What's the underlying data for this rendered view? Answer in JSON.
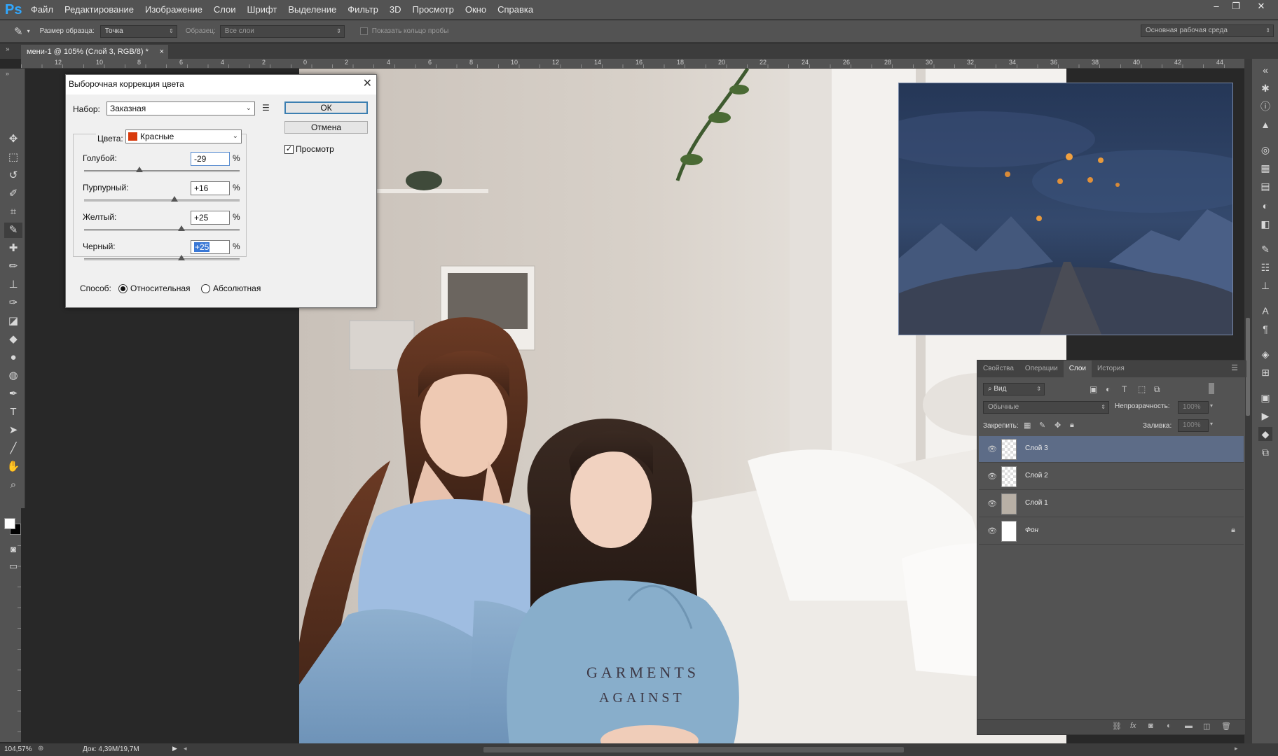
{
  "app": {
    "logo": "Ps"
  },
  "menu": [
    "Файл",
    "Редактирование",
    "Изображение",
    "Слои",
    "Шрифт",
    "Выделение",
    "Фильтр",
    "3D",
    "Просмотр",
    "Окно",
    "Справка"
  ],
  "window_controls": {
    "minimize": "–",
    "restore": "❐",
    "close": "✕"
  },
  "options_bar": {
    "sample_size_label": "Размер образца:",
    "sample_size_value": "Точка",
    "sample_label": "Образец:",
    "sample_value": "Все слои",
    "show_ring_label": "Показать кольцо пробы",
    "workspace": "Основная рабочая среда"
  },
  "document_tab": {
    "title": "мени-1 @ 105% (Слой 3, RGB/8) *",
    "close": "×"
  },
  "ruler_ticks": [
    "12",
    "10",
    "8",
    "6",
    "4",
    "2",
    "0",
    "2",
    "4",
    "6",
    "8",
    "10",
    "12",
    "14",
    "16",
    "18",
    "20",
    "22",
    "24",
    "26",
    "28",
    "30",
    "32",
    "34",
    "36",
    "38",
    "40",
    "42",
    "44"
  ],
  "photo": {
    "shirt_line1": "GARMENTS",
    "shirt_line2": "AGAINST"
  },
  "dialog": {
    "title": "Выборочная коррекция цвета",
    "close": "✕",
    "preset_label": "Набор:",
    "preset_value": "Заказная",
    "ok": "ОК",
    "cancel": "Отмена",
    "preview_label": "Просмотр",
    "preview_checked": true,
    "colors_label": "Цвета:",
    "colors_value": "Красные",
    "colors_swatch": "#d83a0c",
    "sliders": [
      {
        "label": "Голубой:",
        "value": "-29",
        "pct": "%",
        "level": -29
      },
      {
        "label": "Пурпурный:",
        "value": "+16",
        "pct": "%",
        "level": 16
      },
      {
        "label": "Желтый:",
        "value": "+25",
        "pct": "%",
        "level": 25
      },
      {
        "label": "Черный:",
        "value": "+25",
        "pct": "%",
        "level": 25
      }
    ],
    "method_label": "Способ:",
    "method_relative": "Относительная",
    "method_absolute": "Абсолютная",
    "method_selected": "relative"
  },
  "layers_panel": {
    "tabs": [
      "Свойства",
      "Операции",
      "Слои",
      "История"
    ],
    "active_tab": "Слои",
    "filter_kind": "Вид",
    "blend_mode": "Обычные",
    "opacity_label": "Непрозрачность:",
    "opacity_value": "100%",
    "lock_label": "Закрепить:",
    "fill_label": "Заливка:",
    "fill_value": "100%",
    "layers": [
      {
        "name": "Слой 3",
        "selected": true
      },
      {
        "name": "Слой 2",
        "selected": false
      },
      {
        "name": "Слой 1",
        "selected": false
      },
      {
        "name": "Фон",
        "selected": false
      }
    ]
  },
  "status": {
    "zoom": "104,57%",
    "doc": "Док: 4,39M/19,7M"
  }
}
